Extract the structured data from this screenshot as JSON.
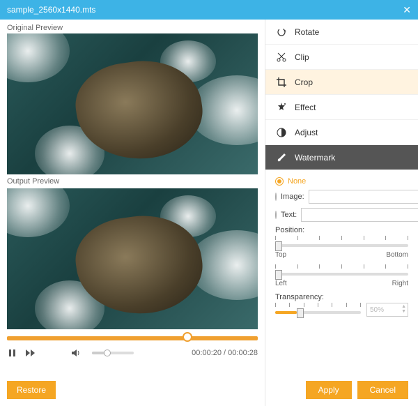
{
  "titlebar": {
    "filename": "sample_2560x1440.mts"
  },
  "previews": {
    "original_label": "Original Preview",
    "output_label": "Output Preview"
  },
  "playback": {
    "current": "00:00:20",
    "total": "00:00:28"
  },
  "buttons": {
    "restore": "Restore",
    "apply": "Apply",
    "cancel": "Cancel"
  },
  "edit_tabs": {
    "rotate": "Rotate",
    "clip": "Clip",
    "crop": "Crop",
    "effect": "Effect",
    "adjust": "Adjust",
    "watermark": "Watermark"
  },
  "watermark": {
    "none_label": "None",
    "image_label": "Image:",
    "text_label": "Text:",
    "position_label": "Position:",
    "pos_top": "Top",
    "pos_bottom": "Bottom",
    "pos_left": "Left",
    "pos_right": "Right",
    "transparency_label": "Transparency:",
    "transparency_value": "50%"
  }
}
